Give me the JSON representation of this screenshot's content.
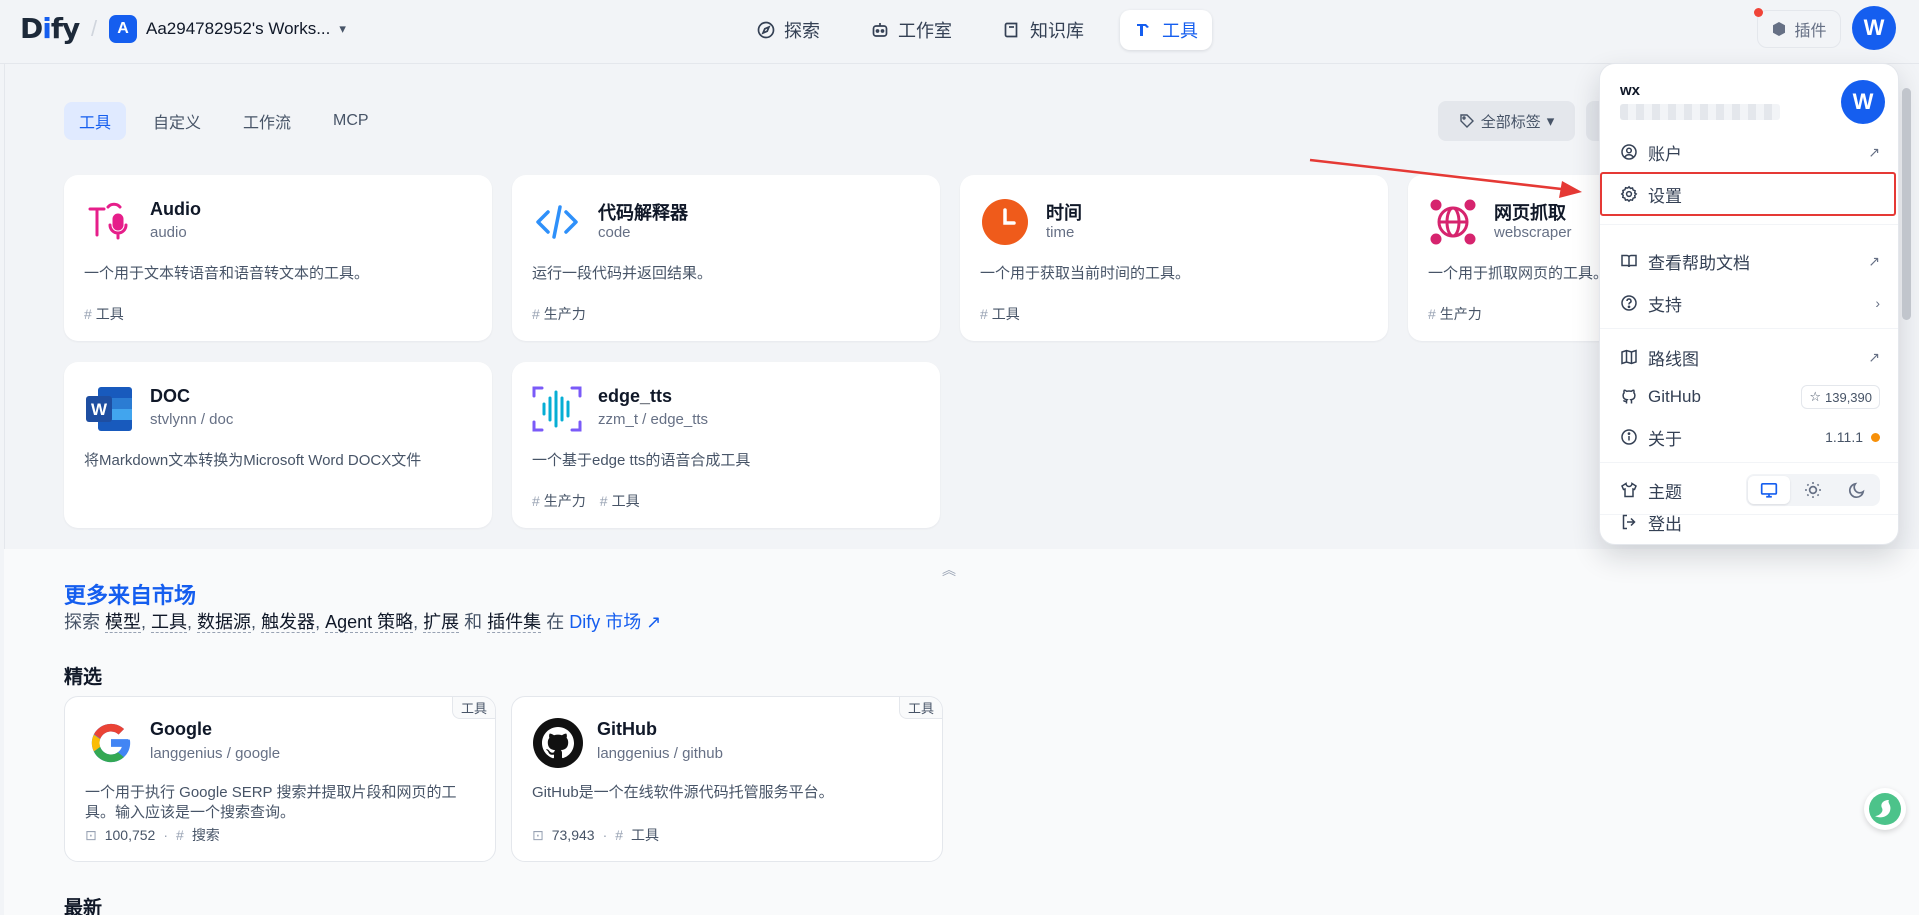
{
  "header": {
    "logo_prefix": "D",
    "logo_i": "i",
    "logo_suffix": "fy",
    "workspace_initial": "A",
    "workspace_name": "Aa294782952's Works...",
    "nav": [
      {
        "label": "探索"
      },
      {
        "label": "工作室"
      },
      {
        "label": "知识库"
      },
      {
        "label": "工具"
      }
    ],
    "plugins_label": "插件",
    "avatar_initial": "W"
  },
  "tabs": [
    "工具",
    "自定义",
    "工作流",
    "MCP"
  ],
  "tag_filter_label": "全部标签",
  "tools": [
    {
      "name": "Audio",
      "sub": "audio",
      "desc": "一个用于文本转语音和语音转文本的工具。",
      "tags": [
        "工具"
      ]
    },
    {
      "name": "代码解释器",
      "sub": "code",
      "desc": "运行一段代码并返回结果。",
      "tags": [
        "生产力"
      ]
    },
    {
      "name": "时间",
      "sub": "time",
      "desc": "一个用于获取当前时间的工具。",
      "tags": [
        "工具"
      ]
    },
    {
      "name": "网页抓取",
      "sub": "webscraper",
      "desc": "一个用于抓取网页的工具。",
      "tags": [
        "生产力"
      ]
    },
    {
      "name": "DOC",
      "sub": "stvlynn / doc",
      "desc": "将Markdown文本转换为Microsoft Word DOCX文件",
      "tags": []
    },
    {
      "name": "edge_tts",
      "sub": "zzm_t / edge_tts",
      "desc": "一个基于edge tts的语音合成工具",
      "tags": [
        "生产力",
        "工具"
      ]
    }
  ],
  "marketplace": {
    "title": "更多来自市场",
    "line_prefix": "探索",
    "line_items": [
      "模型",
      "工具",
      "数据源",
      "触发器",
      "Agent 策略",
      "扩展"
    ],
    "line_and": "和",
    "line_last": "插件集",
    "line_in": "在",
    "line_link": "Dify 市场 ↗",
    "featured_label": "精选",
    "latest_label": "最新",
    "cards": [
      {
        "name": "Google",
        "sub": "langgenius / google",
        "badge": "工具",
        "desc": "一个用于执行 Google SERP 搜索并提取片段和网页的工具。输入应该是一个搜索查询。",
        "installs": "100,752",
        "tag": "搜索"
      },
      {
        "name": "GitHub",
        "sub": "langgenius / github",
        "badge": "工具",
        "desc": "GitHub是一个在线软件源代码托管服务平台。",
        "installs": "73,943",
        "tag": "工具"
      }
    ]
  },
  "dropdown": {
    "user": "wx",
    "avatar_initial": "W",
    "items": {
      "account": "账户",
      "settings": "设置",
      "help": "查看帮助文档",
      "support": "支持",
      "roadmap": "路线图",
      "github": "GitHub",
      "github_stars": "139,390",
      "about": "关于",
      "version": "1.11.1",
      "theme": "主题",
      "logout": "登出"
    }
  },
  "colors": {
    "accent": "#155eef",
    "annotation": "#e53935"
  }
}
